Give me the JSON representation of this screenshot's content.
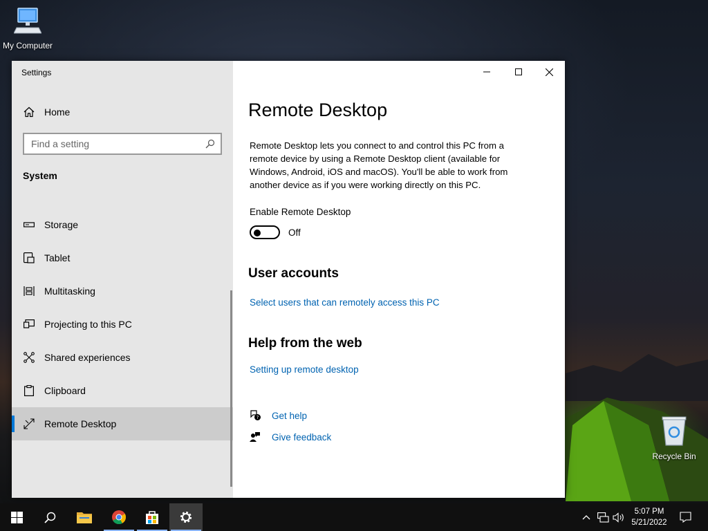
{
  "desktop": {
    "icons": [
      {
        "label": "My Computer"
      },
      {
        "label": "Recycle Bin"
      }
    ]
  },
  "window": {
    "app_title": "Settings",
    "sidebar": {
      "home_label": "Home",
      "search_placeholder": "Find a setting",
      "section": "System",
      "items": [
        {
          "label": "Storage",
          "icon": "storage-icon"
        },
        {
          "label": "Tablet",
          "icon": "tablet-icon"
        },
        {
          "label": "Multitasking",
          "icon": "multitasking-icon"
        },
        {
          "label": "Projecting to this PC",
          "icon": "projecting-icon"
        },
        {
          "label": "Shared experiences",
          "icon": "shared-experiences-icon"
        },
        {
          "label": "Clipboard",
          "icon": "clipboard-icon"
        },
        {
          "label": "Remote Desktop",
          "icon": "remote-desktop-icon",
          "selected": true
        }
      ]
    },
    "content": {
      "title": "Remote Desktop",
      "description": "Remote Desktop lets you connect to and control this PC from a remote device by using a Remote Desktop client (available for Windows, Android, iOS and macOS). You'll be able to work from another device as if you were working directly on this PC.",
      "enable_label": "Enable Remote Desktop",
      "toggle_state": "Off",
      "user_accounts_heading": "User accounts",
      "user_accounts_link": "Select users that can remotely access this PC",
      "help_heading": "Help from the web",
      "help_link": "Setting up remote desktop",
      "get_help": "Get help",
      "give_feedback": "Give feedback"
    }
  },
  "taskbar": {
    "time": "5:07 PM",
    "date": "5/21/2022"
  },
  "colors": {
    "accent": "#0078d7",
    "link": "#0063b1",
    "sidebar_bg": "#e6e6e6",
    "selected_bg": "#cccccc",
    "taskbar_bg": "#101010"
  }
}
